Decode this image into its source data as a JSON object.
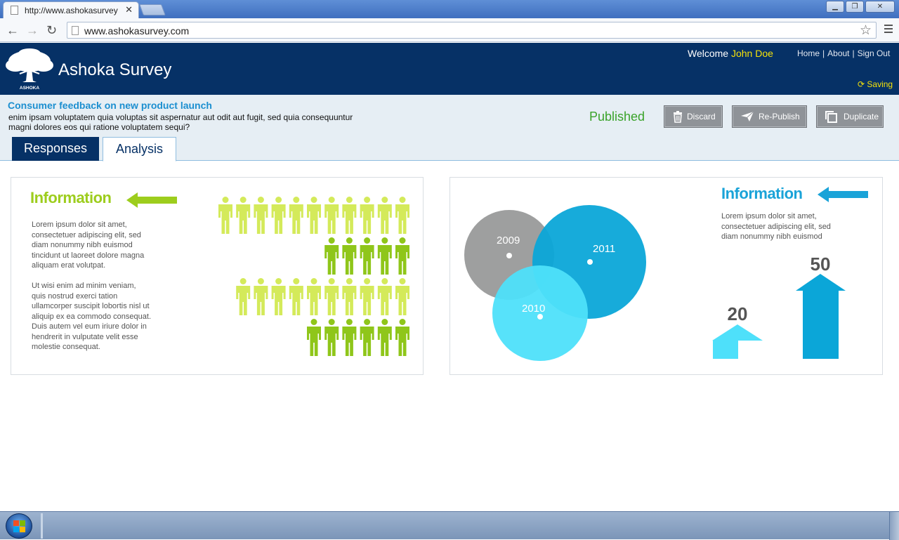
{
  "browser": {
    "tab_title": "http://www.ashokasurvey",
    "tab_close": "✕",
    "url": "www.ashokasurvey.com",
    "window_buttons": [
      "▁",
      "❐",
      "✕"
    ]
  },
  "header": {
    "app_title": "Ashoka Survey",
    "logo_text": "ASHOKA",
    "welcome_label": "Welcome",
    "user_name": "John Doe",
    "links": [
      "Home",
      "About",
      "Sign Out"
    ],
    "saving_label": "Saving",
    "colors": {
      "bg": "#063166",
      "user": "#f5e20a"
    }
  },
  "survey": {
    "title": "Consumer feedback on new product launch",
    "description": "enim ipsam voluptatem quia voluptas sit aspernatur aut odit aut fugit, sed quia consequuntur magni dolores eos qui ratione voluptatem sequi?",
    "status": "Published",
    "actions": {
      "discard": "Discard",
      "republish": "Re-Publish",
      "duplicate": "Duplicate"
    },
    "tabs": {
      "responses": "Responses",
      "analysis": "Analysis"
    },
    "active_tab": "Analysis"
  },
  "left_panel": {
    "title": "Information",
    "paragraph1": "Lorem ipsum dolor sit amet, consectetuer adipiscing elit, sed diam nonummy nibh euismod tincidunt ut laoreet dolore magna aliquam erat volutpat.",
    "paragraph2": "Ut wisi enim ad minim veniam, quis nostrud exerci tation ullamcorper suscipit lobortis nisl ut aliquip ex ea commodo consequat. Duis autem vel eum iriure dolor in hendrerit in vulputate velit esse molestie consequat.",
    "people_rows": [
      {
        "count": 11,
        "color": "#d4ea5a"
      },
      {
        "count": 5,
        "color": "#8fc61a"
      },
      {
        "count": 10,
        "color": "#d4ea5a"
      },
      {
        "count": 6,
        "color": "#8fc61a"
      }
    ],
    "accent": "#9dcd1d"
  },
  "right_panel": {
    "title": "Information",
    "paragraph": "Lorem ipsum dolor sit amet, consectetuer adipiscing elit, sed diam nonummy nibh euismod",
    "circles": [
      {
        "label": "2009",
        "color": "#999a9a"
      },
      {
        "label": "2011",
        "color": "#0ba6d8"
      },
      {
        "label": "2010",
        "color": "#4ee0fa"
      }
    ],
    "arrows": [
      {
        "value": "20",
        "color": "#4ee0fa"
      },
      {
        "value": "50",
        "color": "#0ba6d8"
      }
    ],
    "accent": "#1aa3d8"
  }
}
